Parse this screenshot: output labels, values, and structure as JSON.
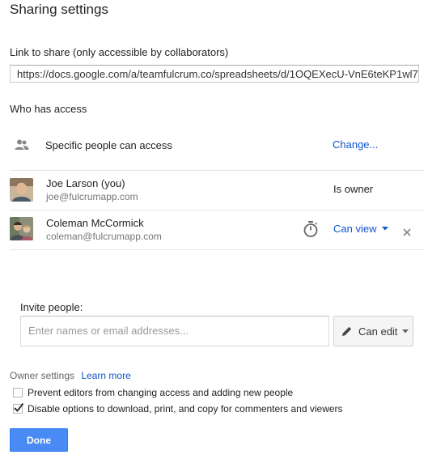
{
  "dialog": {
    "title": "Sharing settings",
    "link_label": "Link to share (only accessible by collaborators)",
    "link_value": "https://docs.google.com/a/teamfulcrum.co/spreadsheets/d/1OQEXecU-VnE6teKP1wl7",
    "access_label": "Who has access"
  },
  "access": {
    "general": {
      "icon": "people-icon",
      "text": "Specific people can access",
      "action": "Change..."
    },
    "people": [
      {
        "name": "Joe Larson (you)",
        "email": "joe@fulcrumapp.com",
        "role": "Is owner"
      },
      {
        "name": "Coleman McCormick",
        "email": "coleman@fulcrumapp.com",
        "role": "Can view",
        "expiration_icon": "timer-icon",
        "remove_icon": "close-icon"
      }
    ]
  },
  "invite": {
    "label": "Invite people:",
    "placeholder": "Enter names or email addresses...",
    "permission": "Can edit",
    "permission_icon": "pencil-icon"
  },
  "owner_settings": {
    "label": "Owner settings",
    "learn_more": "Learn more",
    "options": [
      {
        "label": "Prevent editors from changing access and adding new people",
        "checked": false
      },
      {
        "label": "Disable options to download, print, and copy for commenters and viewers",
        "checked": true
      }
    ]
  },
  "done_label": "Done",
  "colors": {
    "link_blue": "#1155cc",
    "primary_button": "#4a8af4"
  }
}
